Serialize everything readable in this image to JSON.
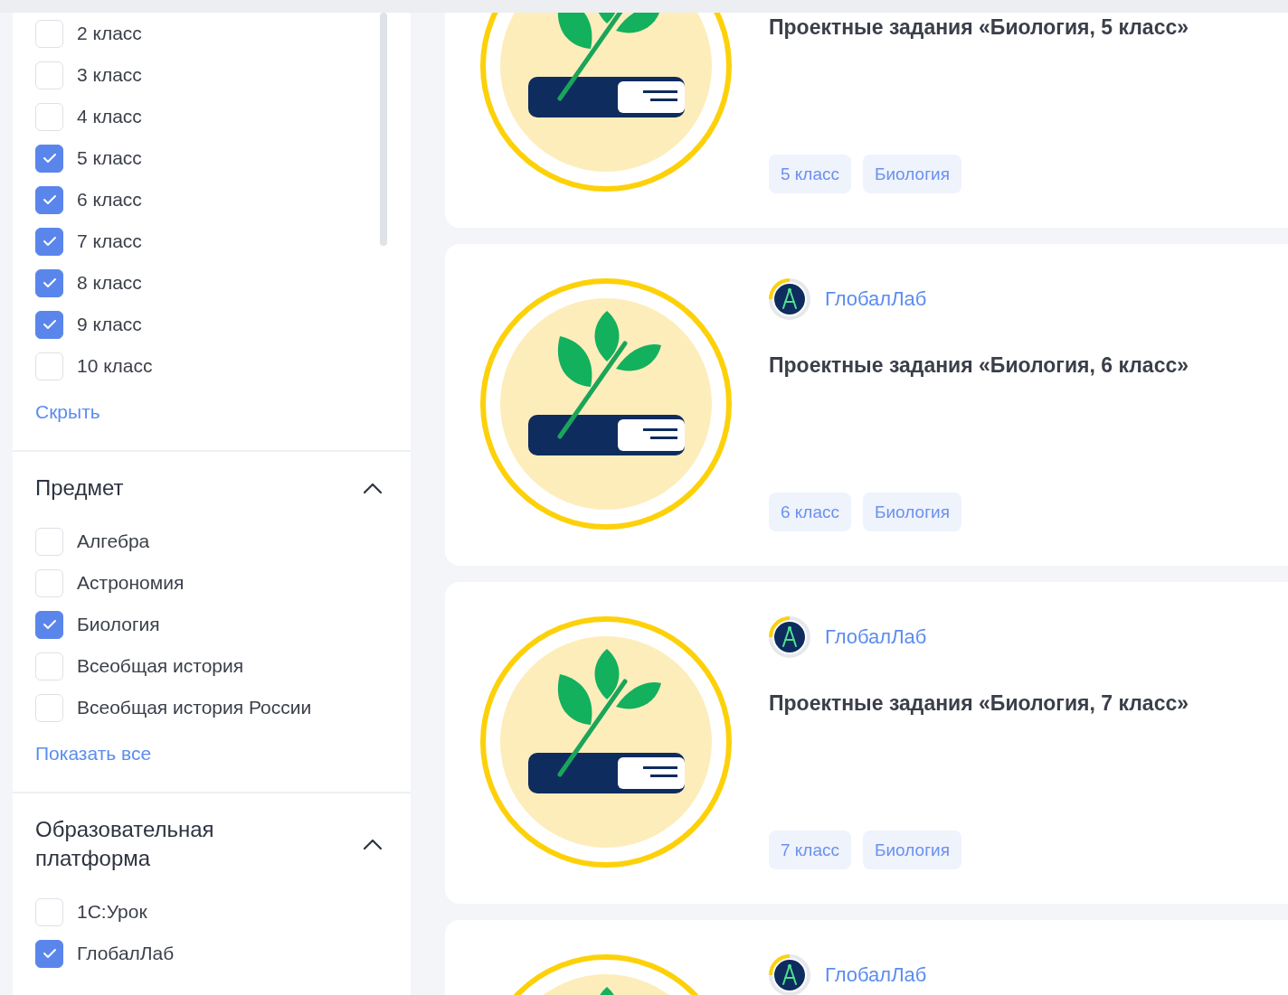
{
  "filters": [
    {
      "options": [
        {
          "label": "2 класс",
          "checked": false
        },
        {
          "label": "3 класс",
          "checked": false
        },
        {
          "label": "4 класс",
          "checked": false
        },
        {
          "label": "5 класс",
          "checked": true
        },
        {
          "label": "6 класс",
          "checked": true
        },
        {
          "label": "7 класс",
          "checked": true
        },
        {
          "label": "8 класс",
          "checked": true
        },
        {
          "label": "9 класс",
          "checked": true
        },
        {
          "label": "10 класс",
          "checked": false
        }
      ],
      "toggle_link": "Скрыть"
    },
    {
      "title": "Предмет",
      "expanded": true,
      "options": [
        {
          "label": "Алгебра",
          "checked": false
        },
        {
          "label": "Астрономия",
          "checked": false
        },
        {
          "label": "Биология",
          "checked": true
        },
        {
          "label": "Всеобщая история",
          "checked": false
        },
        {
          "label": "Всеобщая история России",
          "checked": false
        }
      ],
      "toggle_link": "Показать все"
    },
    {
      "title": "Образовательная платформа",
      "expanded": true,
      "options": [
        {
          "label": "1С:Урок",
          "checked": false
        },
        {
          "label": "ГлобалЛаб",
          "checked": true
        }
      ]
    }
  ],
  "cards": [
    {
      "title": "Проектные задания «Биология, 5 класс»",
      "tags": [
        "5 класс",
        "Биология"
      ]
    },
    {
      "provider": "ГлобалЛаб",
      "title": "Проектные задания «Биология, 6 класс»",
      "tags": [
        "6 класс",
        "Биология"
      ]
    },
    {
      "provider": "ГлобалЛаб",
      "title": "Проектные задания «Биология, 7 класс»",
      "tags": [
        "7 класс",
        "Биология"
      ]
    },
    {
      "provider": "ГлобалЛаб"
    }
  ]
}
